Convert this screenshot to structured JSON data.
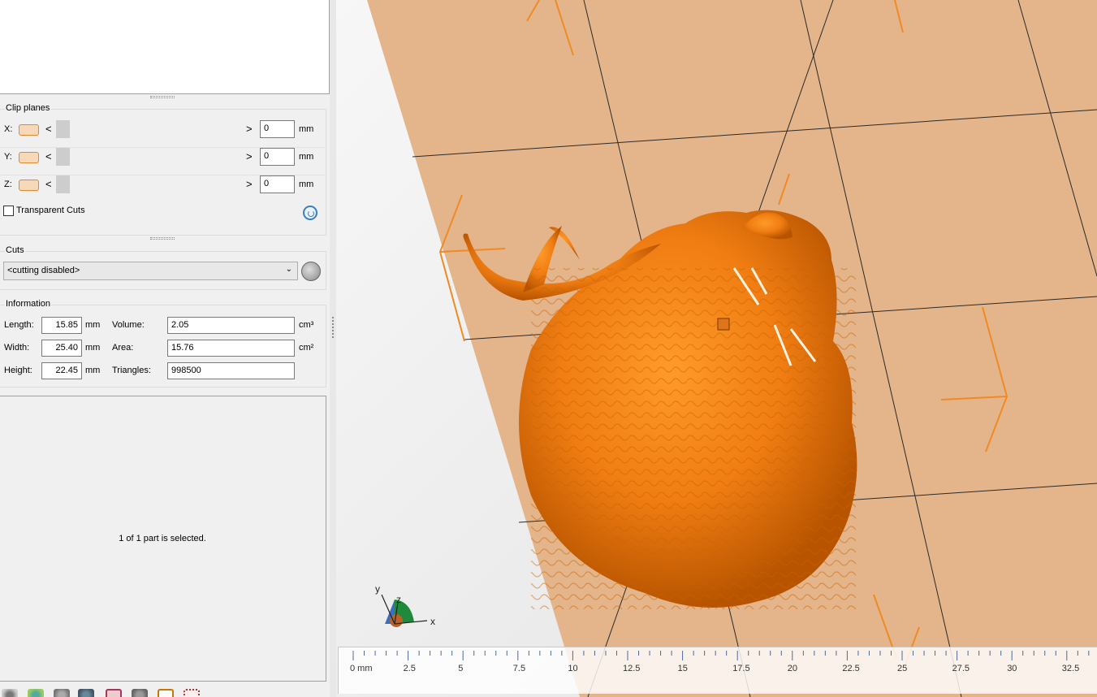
{
  "clip_planes": {
    "title": "Clip planes",
    "unit": "mm",
    "rows": [
      {
        "axis": "X:",
        "value": "0"
      },
      {
        "axis": "Y:",
        "value": "0"
      },
      {
        "axis": "Z:",
        "value": "0"
      }
    ],
    "transparent_cuts_label": "Transparent Cuts",
    "arrow_left": "<",
    "arrow_right": ">"
  },
  "cuts": {
    "title": "Cuts",
    "selected": "<cutting disabled>",
    "chevron": "⌄"
  },
  "information": {
    "title": "Information",
    "length_label": "Length:",
    "length": "15.85",
    "width_label": "Width:",
    "width": "25.40",
    "height_label": "Height:",
    "height": "22.45",
    "dim_unit": "mm",
    "volume_label": "Volume:",
    "volume": "2.05",
    "volume_unit": "cm³",
    "area_label": "Area:",
    "area": "15.76",
    "area_unit": "cm²",
    "triangles_label": "Triangles:",
    "triangles": "998500"
  },
  "status": {
    "selection": "1 of 1 part is selected."
  },
  "gizmo": {
    "x": "x",
    "y": "y",
    "z": "z"
  },
  "ruler": {
    "ticks": [
      "0 mm",
      "2.5",
      "5",
      "7.5",
      "10",
      "12.5",
      "15",
      "17.5",
      "20",
      "22.5",
      "25",
      "27.5",
      "30",
      "32.5"
    ]
  },
  "colors": {
    "model": "#f07d12",
    "plate": "#e4b58a",
    "accent": "#f08a24"
  },
  "toolbar_icons": [
    "gear-icon",
    "globe-icon",
    "sphere-icon",
    "spheres-icon",
    "box-icon",
    "hat-icon",
    "view-icon",
    "grid-icon"
  ]
}
